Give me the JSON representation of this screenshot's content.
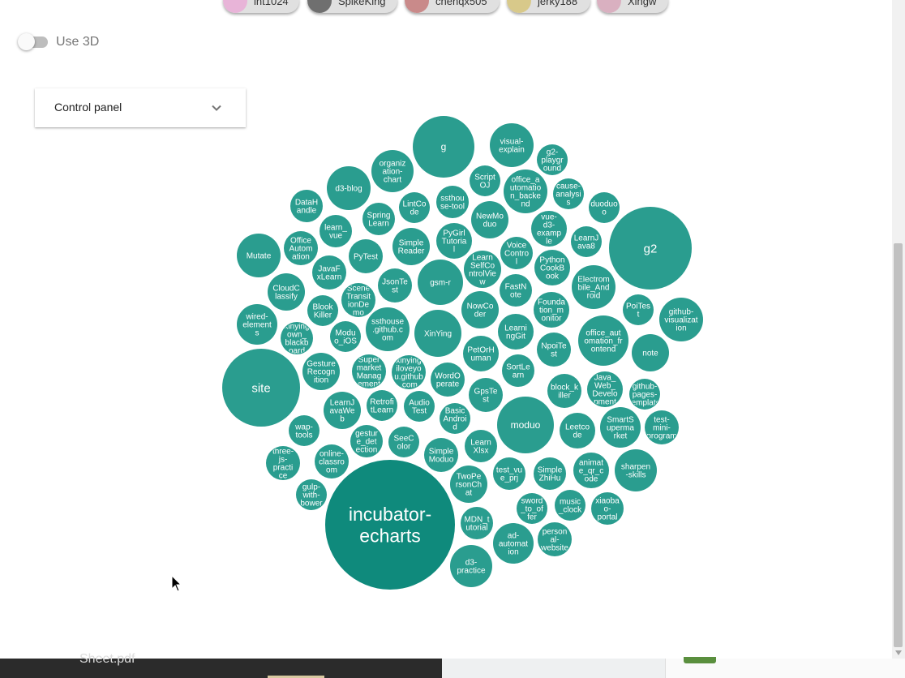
{
  "users": [
    {
      "name": "int1024",
      "avatar": "pink-pattern",
      "color": "#e8b4d8"
    },
    {
      "name": "SpikeKing",
      "avatar": "photo",
      "color": "#6f6f6f"
    },
    {
      "name": "chenqx505",
      "avatar": "anime-girl",
      "color": "#c98a8a"
    },
    {
      "name": "jerky188",
      "avatar": "clock",
      "color": "#d8c98a"
    },
    {
      "name": "Xingw",
      "avatar": "anime-girl",
      "color": "#d9b0c0"
    }
  ],
  "toggle": {
    "label": "Use 3D",
    "checked": false
  },
  "control_panel": {
    "label": "Control panel"
  },
  "colors": {
    "bubble": "#2a9d8f",
    "bubble_large": "#0f8a7c",
    "accent": "#0f8a7c"
  },
  "bubbles": [
    {
      "lines": [
        "g"
      ]
    },
    {
      "lines": [
        "visual-",
        "explain"
      ]
    },
    {
      "lines": [
        "g2-",
        "playgr",
        "ound"
      ]
    },
    {
      "lines": [
        "organiz",
        "ation-",
        "chart"
      ]
    },
    {
      "lines": [
        "Script",
        "OJ"
      ]
    },
    {
      "lines": [
        "office_a",
        "utomatio",
        "n_backe",
        "nd"
      ]
    },
    {
      "lines": [
        "cause-",
        "analysi",
        "s"
      ]
    },
    {
      "lines": [
        "duoduo",
        "o"
      ]
    },
    {
      "lines": [
        "d3-blog"
      ]
    },
    {
      "lines": [
        "ssthou",
        "se-tool"
      ]
    },
    {
      "lines": [
        "LintCo",
        "de"
      ]
    },
    {
      "lines": [
        "DataH",
        "andle"
      ]
    },
    {
      "lines": [
        "Spring",
        "Learn"
      ]
    },
    {
      "lines": [
        "NewMo",
        "duo"
      ]
    },
    {
      "lines": [
        "vue-",
        "d3-",
        "examp",
        "le"
      ]
    },
    {
      "lines": [
        "g2"
      ]
    },
    {
      "lines": [
        "LearnJ",
        "ava8"
      ]
    },
    {
      "lines": [
        "learn_",
        "vue"
      ]
    },
    {
      "lines": [
        "Office",
        "Autom",
        "ation"
      ]
    },
    {
      "lines": [
        "Simple",
        "Reader"
      ]
    },
    {
      "lines": [
        "PyGirl",
        "Tutoria",
        "l"
      ]
    },
    {
      "lines": [
        "Voice",
        "Contro",
        "l"
      ]
    },
    {
      "lines": [
        "Mutate"
      ]
    },
    {
      "lines": [
        "PyTest"
      ]
    },
    {
      "lines": [
        "Learn",
        "SelfCo",
        "ntrolVie",
        "w"
      ]
    },
    {
      "lines": [
        "Python",
        "CookB",
        "ook"
      ]
    },
    {
      "lines": [
        "JavaF",
        "xLearn"
      ]
    },
    {
      "lines": [
        "gsm-r"
      ]
    },
    {
      "lines": [
        "JsonTe",
        "st"
      ]
    },
    {
      "lines": [
        "Electrom",
        "bile_And",
        "roid"
      ]
    },
    {
      "lines": [
        "CloudC",
        "lassify"
      ]
    },
    {
      "lines": [
        "Scene",
        "Transit",
        "ionDe",
        "mo"
      ]
    },
    {
      "lines": [
        "FastN",
        "ote"
      ]
    },
    {
      "lines": [
        "Blook",
        "Killer"
      ]
    },
    {
      "lines": [
        "NowCo",
        "der"
      ]
    },
    {
      "lines": [
        "Founda",
        "tion_m",
        "onitor"
      ]
    },
    {
      "lines": [
        "PoiTes",
        "t"
      ]
    },
    {
      "lines": [
        "github-",
        "visualizat",
        "ion"
      ]
    },
    {
      "lines": [
        "wired-",
        "element",
        "s"
      ]
    },
    {
      "lines": [
        "ssthouse",
        ".github.c",
        "om"
      ]
    },
    {
      "lines": [
        "XinYing"
      ]
    },
    {
      "lines": [
        "xinying",
        "own_",
        "blackb",
        "oard"
      ]
    },
    {
      "lines": [
        "Modu",
        "o_iOS"
      ]
    },
    {
      "lines": [
        "Learni",
        "ngGit"
      ]
    },
    {
      "lines": [
        "office_aut",
        "omation_fr",
        "ontend"
      ]
    },
    {
      "lines": [
        "NpoiTe",
        "st"
      ]
    },
    {
      "lines": [
        "note"
      ]
    },
    {
      "lines": [
        "site"
      ]
    },
    {
      "lines": [
        "PetOrH",
        "uman"
      ]
    },
    {
      "lines": [
        "Gesture",
        "Recogn",
        "ition"
      ]
    },
    {
      "lines": [
        "Super",
        "market",
        "Manag",
        "ement"
      ]
    },
    {
      "lines": [
        "xinying",
        "iloveyo",
        "u.github",
        ".com"
      ]
    },
    {
      "lines": [
        "SortLe",
        "arn"
      ]
    },
    {
      "lines": [
        "WordO",
        "perate"
      ]
    },
    {
      "lines": [
        "Java_",
        "Web_",
        "Develo",
        "pment"
      ]
    },
    {
      "lines": [
        "block_k",
        "iller"
      ]
    },
    {
      "lines": [
        "github-",
        "pages-",
        "template"
      ]
    },
    {
      "lines": [
        "GpsTe",
        "st"
      ]
    },
    {
      "lines": [
        "Retrofi",
        "tLearn"
      ]
    },
    {
      "lines": [
        "LearnJ",
        "avaWe",
        "b"
      ]
    },
    {
      "lines": [
        "Audio",
        "Test"
      ]
    },
    {
      "lines": [
        "moduo"
      ]
    },
    {
      "lines": [
        "Basic",
        "Androi",
        "d"
      ]
    },
    {
      "lines": [
        "SmartS",
        "uperma",
        "rket"
      ]
    },
    {
      "lines": [
        "test-",
        "mini-",
        "program"
      ]
    },
    {
      "lines": [
        "wap-",
        "tools"
      ]
    },
    {
      "lines": [
        "Leetco",
        "de"
      ]
    },
    {
      "lines": [
        "gestur",
        "e_det",
        "ection"
      ]
    },
    {
      "lines": [
        "SeeC",
        "olor"
      ]
    },
    {
      "lines": [
        "Learn",
        "Xlsx"
      ]
    },
    {
      "lines": [
        "online-",
        "classro",
        "om"
      ]
    },
    {
      "lines": [
        "Simple",
        "Moduo"
      ]
    },
    {
      "lines": [
        "three-",
        "js-",
        "practi",
        "ce"
      ]
    },
    {
      "lines": [
        "test_vu",
        "e_prj"
      ]
    },
    {
      "lines": [
        "Simple",
        "ZhiHu"
      ]
    },
    {
      "lines": [
        "animat",
        "e_qr_c",
        "ode"
      ]
    },
    {
      "lines": [
        "sharpen",
        "-skills"
      ]
    },
    {
      "lines": [
        "TwoPe",
        "rsonCh",
        "at"
      ]
    },
    {
      "lines": [
        "gulp-",
        "with-",
        "bower"
      ]
    },
    {
      "lines": [
        "incubator-",
        "echarts"
      ]
    },
    {
      "lines": [
        "sword",
        "_to_of",
        "fer"
      ]
    },
    {
      "lines": [
        "music",
        "_clock"
      ]
    },
    {
      "lines": [
        "xiaoba",
        "o-",
        "portal"
      ]
    },
    {
      "lines": [
        "MDN_t",
        "utorial"
      ]
    },
    {
      "lines": [
        "ad-",
        "automat",
        "ion"
      ]
    },
    {
      "lines": [
        "person",
        "al-",
        "website"
      ]
    },
    {
      "lines": [
        "d3-",
        "practice"
      ]
    }
  ],
  "taskbar": {
    "left_item": "Sheet.pdf"
  }
}
